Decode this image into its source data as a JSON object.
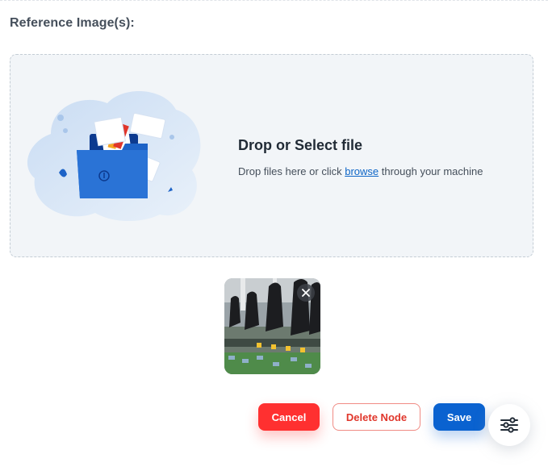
{
  "section": {
    "label": "Reference Image(s):"
  },
  "dropzone": {
    "title": "Drop or Select file",
    "hint_before": "Drop files here or click ",
    "hint_link": "browse",
    "hint_after": " through your machine"
  },
  "uploaded": {
    "remove_icon": "close-icon"
  },
  "actions": {
    "cancel_label": "Cancel",
    "delete_label": "Delete Node",
    "save_label": "Save",
    "settings_icon": "sliders-icon"
  },
  "colors": {
    "cancel": "#ff3030",
    "delete_text": "#e0362b",
    "save": "#0a62d0",
    "link": "#0f66c7",
    "dropzone_bg": "#f2f5f8"
  }
}
